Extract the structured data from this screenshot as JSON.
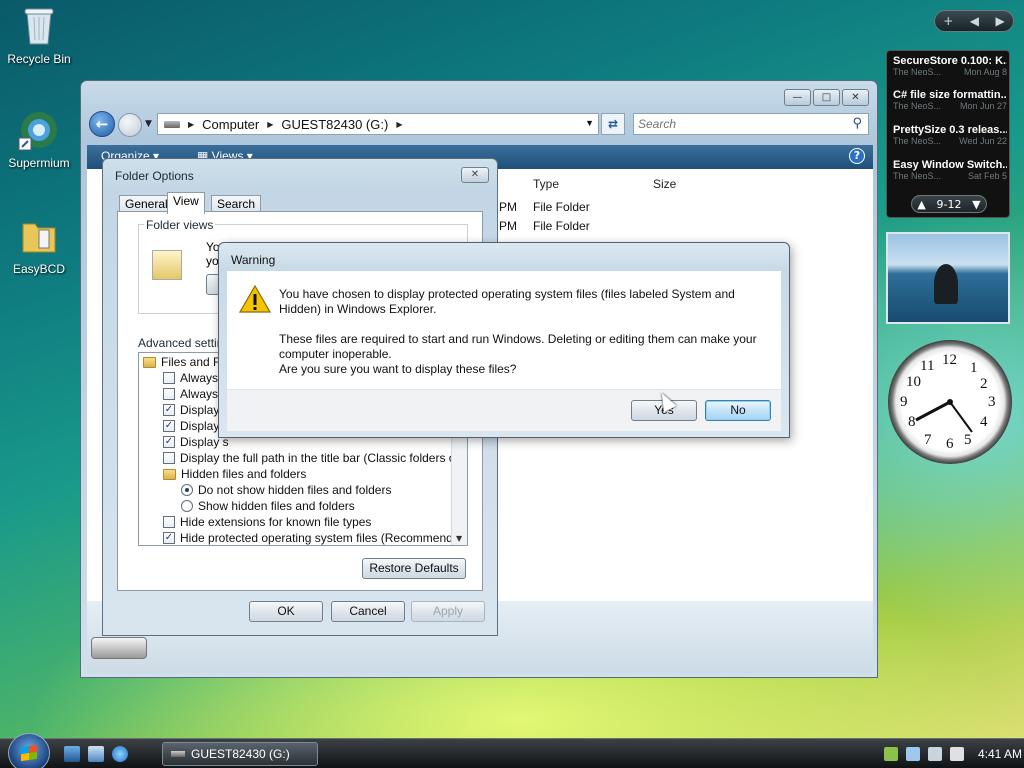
{
  "desktop": {
    "icons": [
      {
        "label": "Recycle Bin"
      },
      {
        "label": "Supermium"
      },
      {
        "label": "EasyBCD"
      }
    ]
  },
  "explorer": {
    "breadcrumb": [
      "Computer",
      "GUEST82430 (G:)"
    ],
    "search_placeholder": "Search",
    "toolbar": {
      "organize": "Organize",
      "views": "Views"
    },
    "columns": [
      "Type",
      "Size"
    ],
    "rows": [
      {
        "time": "PM",
        "type": "File Folder"
      },
      {
        "time": "PM",
        "type": "File Folder"
      }
    ]
  },
  "folder_options": {
    "title": "Folder Options",
    "tabs": [
      "General",
      "View",
      "Search"
    ],
    "active_tab": "View",
    "folder_views_label": "Folder views",
    "folder_views_text": "You",
    "folder_views_text2": "you",
    "advanced_label": "Advanced setting",
    "tree": [
      {
        "kind": "folder",
        "label": "Files and Fol"
      },
      {
        "kind": "check",
        "checked": false,
        "label": "Always s"
      },
      {
        "kind": "check",
        "checked": false,
        "label": "Always s"
      },
      {
        "kind": "check",
        "checked": true,
        "label": "Display f"
      },
      {
        "kind": "check",
        "checked": true,
        "label": "Display f"
      },
      {
        "kind": "check",
        "checked": true,
        "label": "Display s"
      },
      {
        "kind": "check",
        "checked": false,
        "label": "Display the full path in the title bar (Classic folders only)"
      },
      {
        "kind": "folder",
        "label": "Hidden files and folders"
      },
      {
        "kind": "radio",
        "checked": true,
        "label": "Do not show hidden files and folders"
      },
      {
        "kind": "radio",
        "checked": false,
        "label": "Show hidden files and folders"
      },
      {
        "kind": "check",
        "checked": false,
        "label": "Hide extensions for known file types"
      },
      {
        "kind": "check",
        "checked": true,
        "label": "Hide protected operating system files (Recommended)"
      }
    ],
    "restore_defaults": "Restore Defaults",
    "ok": "OK",
    "cancel": "Cancel",
    "apply": "Apply"
  },
  "warning": {
    "title": "Warning",
    "line1": "You have chosen to display protected operating system files (files labeled System and",
    "line2": "Hidden) in Windows Explorer.",
    "line3": "These files are required to start and run Windows. Deleting or editing them can make your",
    "line4": "computer inoperable.",
    "line5": "Are you sure you want to display these files?",
    "yes": "Yes",
    "no": "No"
  },
  "sidebar": {
    "feeds": [
      {
        "title": "SecureStore 0.100: K...",
        "source": "The NeoS...",
        "date": "Mon Aug 8"
      },
      {
        "title": "C# file size formattin...",
        "source": "The NeoS...",
        "date": "Mon Jun 27"
      },
      {
        "title": "PrettySize 0.3 releas...",
        "source": "The NeoS...",
        "date": "Wed Jun 22"
      },
      {
        "title": "Easy Window Switch...",
        "source": "The NeoS...",
        "date": "Sat Feb 5"
      }
    ],
    "pager": "9-12",
    "clock_numbers": [
      "12",
      "1",
      "2",
      "3",
      "4",
      "5",
      "6",
      "7",
      "8",
      "9",
      "10",
      "11"
    ]
  },
  "taskbar": {
    "task_label": "GUEST82430 (G:)",
    "time": "4:41 AM"
  },
  "colors": {
    "accent": "#1e4f7a",
    "default_button": "#3c7fb1"
  }
}
